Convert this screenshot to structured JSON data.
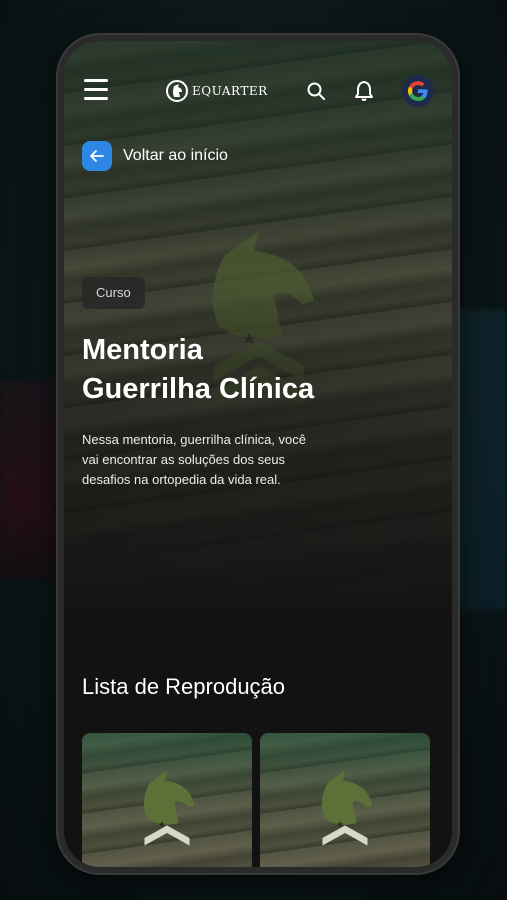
{
  "header": {
    "brand": "EQUARTER",
    "menu_icon": "hamburger-menu-icon",
    "search_icon": "search-icon",
    "notification_icon": "bell-icon",
    "avatar_letter": "G"
  },
  "back": {
    "label": "Voltar ao início"
  },
  "course": {
    "tag": "Curso",
    "title_line1": "Mentoria",
    "title_line2": "Guerrilha Clínica",
    "description": "Nessa mentoria, guerrilha clínica, você vai encontrar as soluções dos seus desafios na ortopedia da vida real."
  },
  "playlist": {
    "title": "Lista de Reprodução",
    "items": [
      {},
      {}
    ]
  },
  "colors": {
    "accent": "#2e86e6",
    "background": "#121212"
  }
}
